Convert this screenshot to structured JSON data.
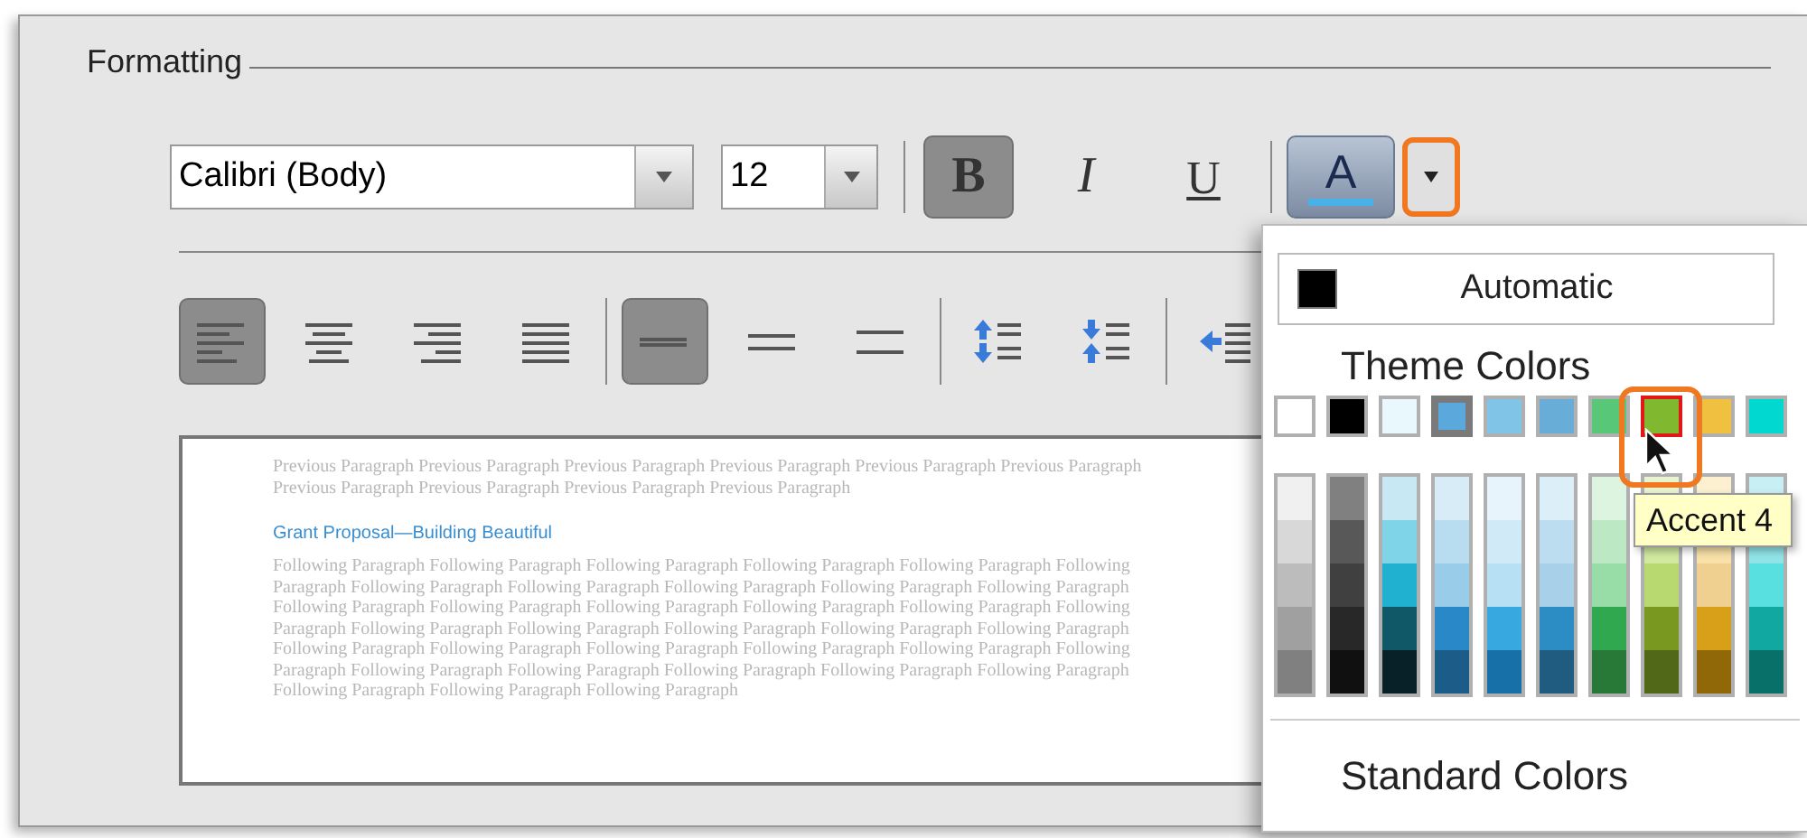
{
  "group": {
    "title": "Formatting"
  },
  "font_field": {
    "value": "Calibri (Body)"
  },
  "size_field": {
    "value": "12"
  },
  "style_buttons": [
    {
      "kind": "bold",
      "label": "B",
      "selected": true
    },
    {
      "kind": "italic",
      "label": "I",
      "selected": false
    },
    {
      "kind": "underline",
      "label": "U",
      "selected": false
    }
  ],
  "font_color_button": {
    "label": "A",
    "dropdown_highlighted": true
  },
  "paragraph_buttons": [
    {
      "kind": "align-left",
      "selected": true
    },
    {
      "kind": "align-center",
      "selected": false
    },
    {
      "kind": "align-right",
      "selected": false
    },
    {
      "kind": "justify",
      "selected": false
    },
    {
      "kind": "single-spacing",
      "selected": true
    },
    {
      "kind": "one-half-spacing",
      "selected": false
    },
    {
      "kind": "double-spacing",
      "selected": false
    },
    {
      "kind": "space-before",
      "selected": false
    },
    {
      "kind": "space-after",
      "selected": false
    },
    {
      "kind": "indent",
      "selected": false
    }
  ],
  "preview": {
    "previous_paragraph": "Previous Paragraph Previous Paragraph Previous Paragraph Previous Paragraph Previous Paragraph Previous Paragraph Previous Paragraph Previous Paragraph Previous Paragraph Previous Paragraph",
    "heading": "Grant Proposal—Building Beautiful",
    "following_paragraph": "Following Paragraph Following Paragraph Following Paragraph Following Paragraph Following Paragraph Following Paragraph Following Paragraph Following Paragraph Following Paragraph Following Paragraph Following Paragraph Following Paragraph Following Paragraph Following Paragraph Following Paragraph Following Paragraph Following Paragraph Following Paragraph Following Paragraph Following Paragraph Following Paragraph Following Paragraph Following Paragraph Following Paragraph Following Paragraph Following Paragraph Following Paragraph Following Paragraph Following Paragraph Following Paragraph Following Paragraph Following Paragraph Following Paragraph Following Paragraph Following Paragraph Following Paragraph"
  },
  "color_menu": {
    "automatic": {
      "label": "Automatic"
    },
    "theme_heading": "Theme Colors",
    "theme_swatches": [
      {
        "color": "#ffffff",
        "selected": false,
        "highlighted": false
      },
      {
        "color": "#000000",
        "selected": false,
        "highlighted": false
      },
      {
        "color": "#e8f8fc",
        "selected": false,
        "highlighted": false
      },
      {
        "color": "#5aa8dc",
        "selected": true,
        "highlighted": false
      },
      {
        "color": "#80c4e8",
        "selected": false,
        "highlighted": false
      },
      {
        "color": "#68acd8",
        "selected": false,
        "highlighted": false
      },
      {
        "color": "#58c878",
        "selected": false,
        "highlighted": false
      },
      {
        "color": "#80b830",
        "selected": false,
        "highlighted": true
      },
      {
        "color": "#f0c040",
        "selected": false,
        "highlighted": false
      },
      {
        "color": "#00d8d0",
        "selected": false,
        "highlighted": false
      }
    ],
    "shade_columns": [
      {
        "shades": [
          {
            "color": "#f0f0f0"
          },
          {
            "color": "#d8d8d8"
          },
          {
            "color": "#bcbcbc"
          },
          {
            "color": "#a0a0a0"
          },
          {
            "color": "#808080"
          }
        ]
      },
      {
        "shades": [
          {
            "color": "#808080"
          },
          {
            "color": "#585858"
          },
          {
            "color": "#404040"
          },
          {
            "color": "#282828"
          },
          {
            "color": "#101010"
          }
        ]
      },
      {
        "shades": [
          {
            "color": "#c8e8f4"
          },
          {
            "color": "#80d4e8"
          },
          {
            "color": "#20b0d0"
          },
          {
            "color": "#105868"
          },
          {
            "color": "#082028"
          }
        ]
      },
      {
        "shades": [
          {
            "color": "#d8ecf8"
          },
          {
            "color": "#b8dcf0"
          },
          {
            "color": "#98cce8"
          },
          {
            "color": "#2888c8"
          },
          {
            "color": "#1c5c88"
          }
        ]
      },
      {
        "shades": [
          {
            "color": "#e8f4fc"
          },
          {
            "color": "#d0eaf8"
          },
          {
            "color": "#b8e0f4"
          },
          {
            "color": "#38a8e0"
          },
          {
            "color": "#1870a8"
          }
        ]
      },
      {
        "shades": [
          {
            "color": "#dceef8"
          },
          {
            "color": "#bcdcf0"
          },
          {
            "color": "#a8d0e8"
          },
          {
            "color": "#2c8cc4"
          },
          {
            "color": "#205c80"
          }
        ]
      },
      {
        "shades": [
          {
            "color": "#dcf4e0"
          },
          {
            "color": "#bce8c4"
          },
          {
            "color": "#98dca8"
          },
          {
            "color": "#30a850"
          },
          {
            "color": "#287838"
          }
        ]
      },
      {
        "shades": [
          {
            "color": "#e8f4d0"
          },
          {
            "color": "#d0e8a0"
          },
          {
            "color": "#b8d870"
          },
          {
            "color": "#789820"
          },
          {
            "color": "#506818"
          }
        ]
      },
      {
        "shades": [
          {
            "color": "#fcf0d0"
          },
          {
            "color": "#f8e0a8"
          },
          {
            "color": "#f0d090"
          },
          {
            "color": "#d8a018"
          },
          {
            "color": "#906808"
          }
        ]
      },
      {
        "shades": [
          {
            "color": "#c8f0f4"
          },
          {
            "color": "#90e4e8"
          },
          {
            "color": "#58e0e0"
          },
          {
            "color": "#10a8a0"
          },
          {
            "color": "#087068"
          }
        ]
      }
    ],
    "tooltip": "Accent 4",
    "standard_heading": "Standard Colors"
  }
}
